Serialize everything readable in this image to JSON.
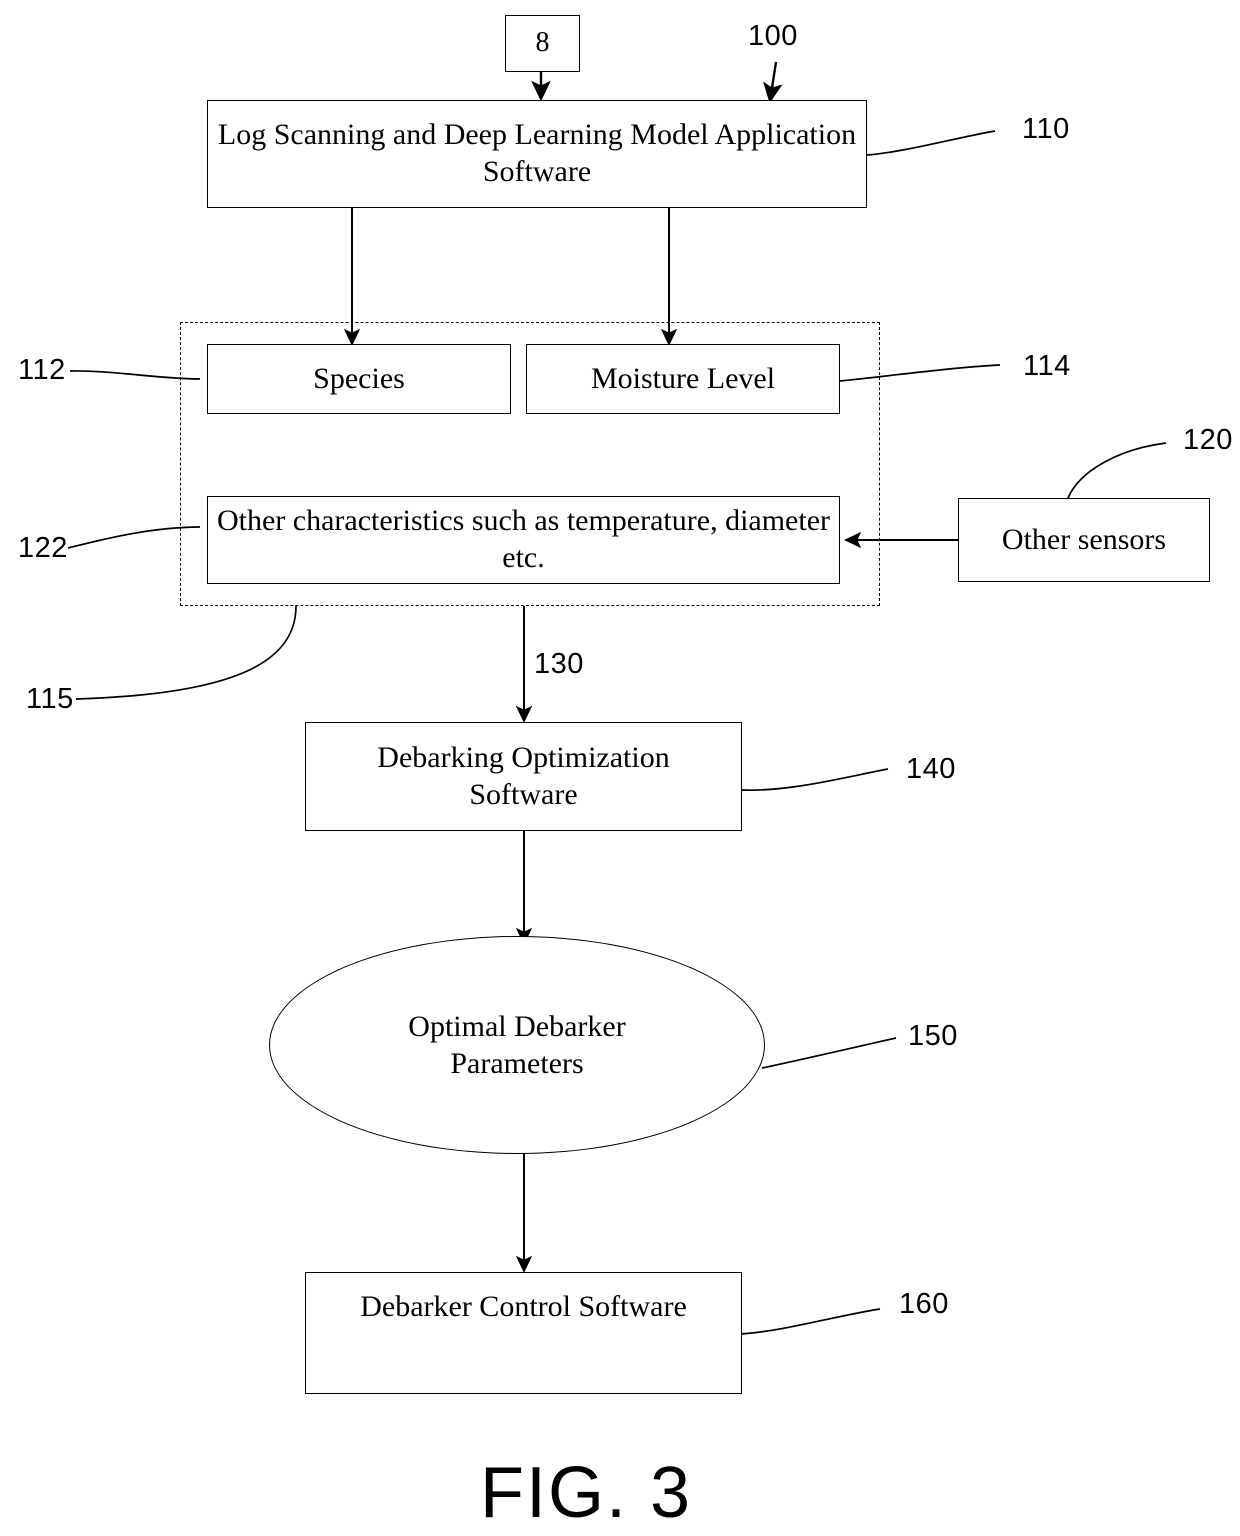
{
  "figure": {
    "caption": "FIG. 3",
    "system_ref": "100"
  },
  "nodes": {
    "source_ref_box": {
      "label": "8",
      "ref": ""
    },
    "log_scanning": {
      "label": "Log Scanning and Deep Learning Model Application Software",
      "ref": "110"
    },
    "species": {
      "label": "Species",
      "ref": "112"
    },
    "moisture": {
      "label": "Moisture Level",
      "ref": "114"
    },
    "other_characteristics": {
      "label": "Other characteristics such as temperature, diameter etc.",
      "ref": "122"
    },
    "characteristics_group": {
      "ref": "115"
    },
    "other_sensors": {
      "label": "Other sensors",
      "ref": "120"
    },
    "debarking_optimization": {
      "label": "Debarking Optimization Software",
      "ref": "140"
    },
    "optimal_parameters": {
      "label": "Optimal Debarker Parameters",
      "ref": "150"
    },
    "debarker_control": {
      "label": "Debarker Control Software",
      "ref": "160"
    }
  },
  "connectors": {
    "group_to_optimization": {
      "ref": "130"
    }
  }
}
